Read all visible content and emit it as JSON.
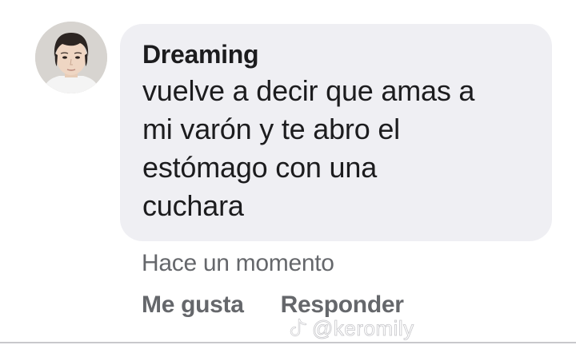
{
  "comment": {
    "author": "Dreaming",
    "text_lines": [
      "vuelve a decir que amas a",
      "mi varón y te abro el",
      "estómago con una",
      "cuchara"
    ],
    "timestamp": "Hace un momento"
  },
  "actions": {
    "like_label": "Me gusta",
    "reply_label": "Responder"
  },
  "watermark": {
    "handle": "@keromily",
    "icon": "tiktok-icon"
  },
  "colors": {
    "bubble": "#efeff3",
    "text": "#1c1c1e",
    "secondary_text": "#65676b"
  }
}
